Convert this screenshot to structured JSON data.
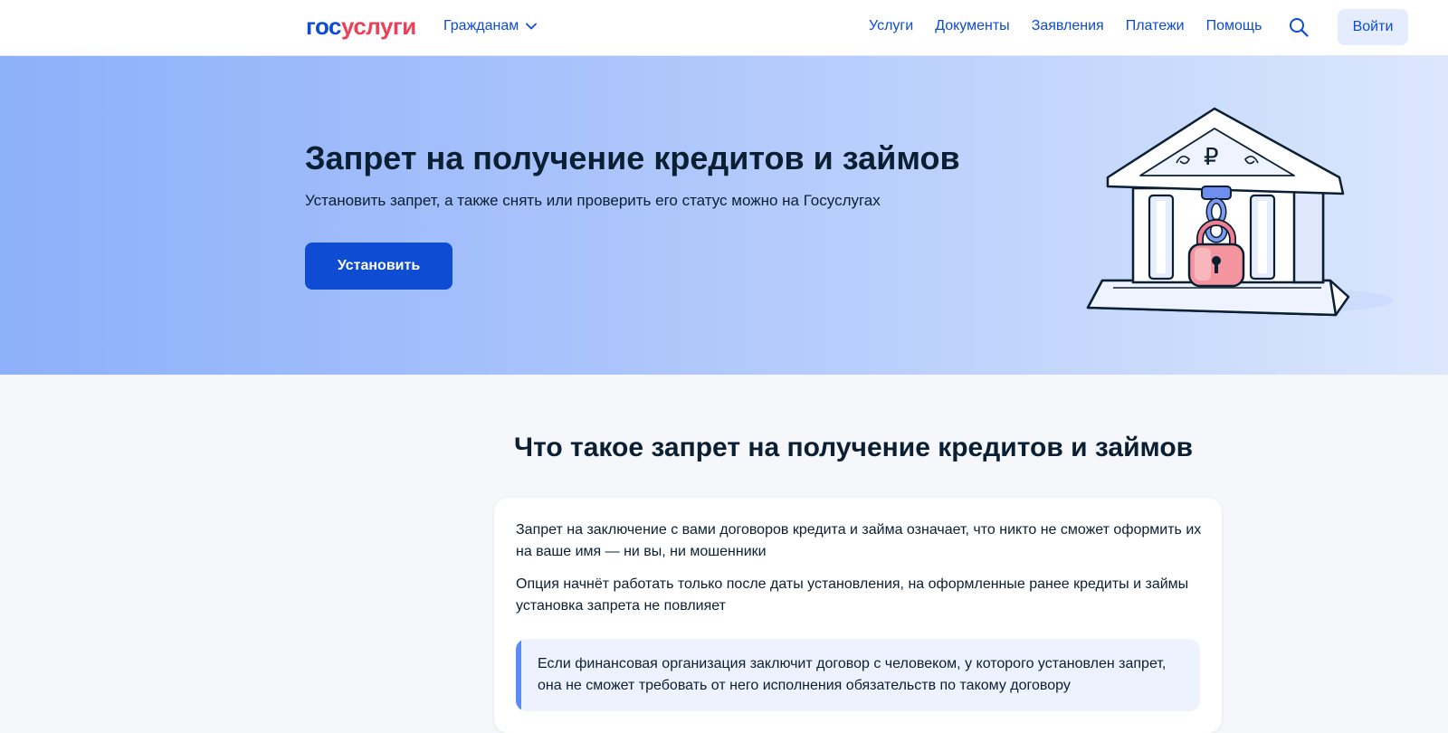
{
  "header": {
    "logo_part1": "гос",
    "logo_part2": "услуги",
    "audience": "Гражданам",
    "nav": [
      "Услуги",
      "Документы",
      "Заявления",
      "Платежи",
      "Помощь"
    ],
    "login": "Войти",
    "icons": {
      "search": "search-icon",
      "audience_toggle": "chevron-down-icon"
    }
  },
  "hero": {
    "title": "Запрет на получение кредитов и займов",
    "subtitle": "Установить запрет, а также снять или проверить его статус можно на Госуслугах",
    "button": "Установить",
    "illustration": "bank-with-padlock-illustration"
  },
  "content": {
    "title": "Что такое запрет на получение кредитов и займов",
    "paragraph1": "Запрет на заключение с вами договоров кредита и займа означает, что никто не сможет оформить их на ваше имя — ни вы, ни мошенники",
    "paragraph2": "Опция начнёт работать только после даты установления, на оформленные ранее кредиты и займы установка запрета не повлияет",
    "note": "Если финансовая организация заключит договор с человеком, у которого установлен запрет, она не сможет требовать от него исполнения обязательств по такому договору"
  },
  "colors": {
    "brand_blue": "#0d4cd3",
    "brand_red": "#ee3f58",
    "text": "#0b1f33",
    "note_bg": "#edf2fe",
    "note_bar": "#5b8cf5"
  }
}
